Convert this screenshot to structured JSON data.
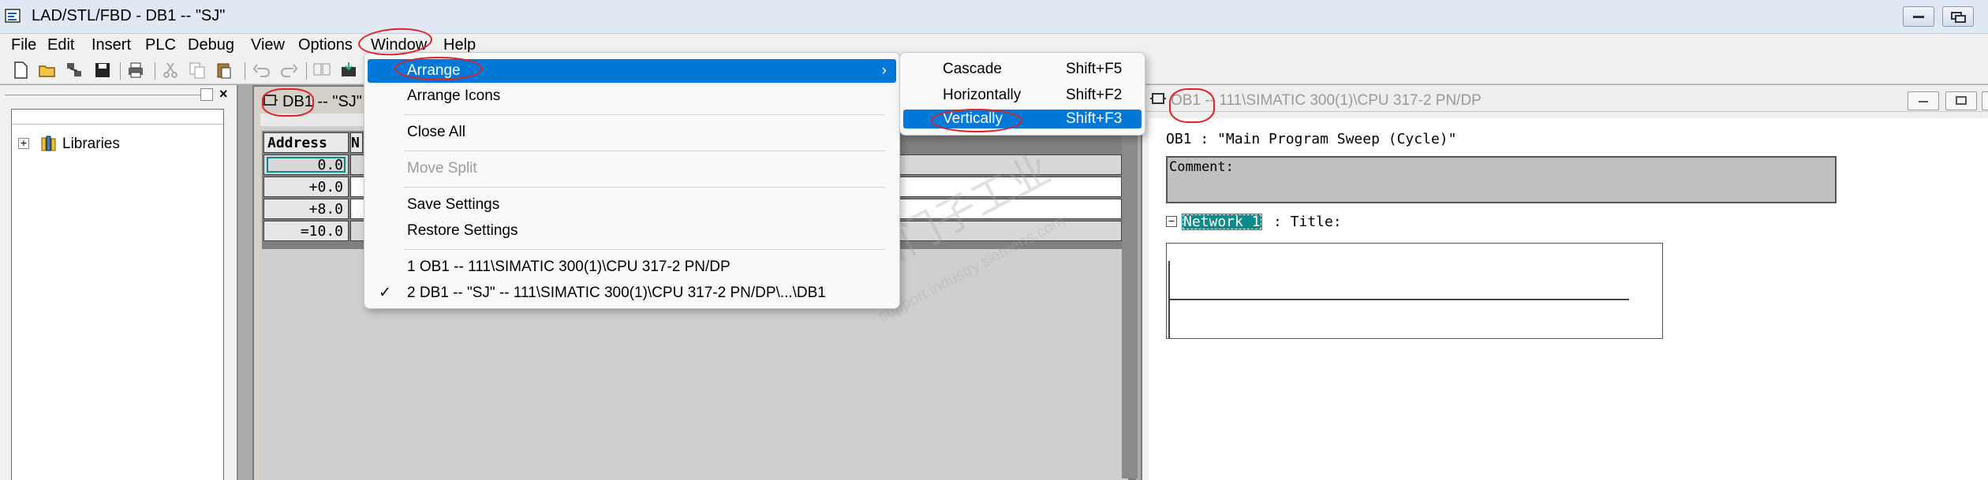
{
  "window": {
    "title": "LAD/STL/FBD  - DB1 -- \"SJ\""
  },
  "menubar": [
    "File",
    "Edit",
    "Insert",
    "PLC",
    "Debug",
    "View",
    "Options",
    "Window",
    "Help"
  ],
  "libraries": {
    "label": "Libraries"
  },
  "db_window": {
    "title": "DB1 -- \"SJ\"",
    "table": {
      "header": [
        "Address",
        "N"
      ],
      "rows": [
        {
          "address": "0.0"
        },
        {
          "address": "+0.0"
        },
        {
          "address": "+8.0"
        },
        {
          "address": "=10.0"
        }
      ]
    }
  },
  "ob_window": {
    "title": "OB1 -- 111\\SIMATIC 300(1)\\CPU 317-2 PN/DP",
    "block_title": "OB1 :  \"Main Program Sweep (Cycle)\"",
    "comment_label": "Comment:",
    "network_label": "Network 1",
    "network_title": ": Title:"
  },
  "window_menu": {
    "items": [
      {
        "label": "Arrange",
        "highlighted": true,
        "submenu": true
      },
      {
        "label": "Arrange Icons"
      },
      {
        "label": "Close All"
      },
      {
        "label": "Move Split",
        "disabled": true
      },
      {
        "label": "Save Settings"
      },
      {
        "label": "Restore Settings"
      },
      {
        "label": "1 OB1 -- 111\\SIMATIC 300(1)\\CPU 317-2 PN/DP"
      },
      {
        "label": "2 DB1 -- \"SJ\" -- 111\\SIMATIC 300(1)\\CPU 317-2 PN/DP\\...\\DB1",
        "checked": true
      }
    ]
  },
  "arrange_menu": {
    "items": [
      {
        "label": "Cascade",
        "shortcut": "Shift+F5"
      },
      {
        "label": "Horizontally",
        "shortcut": "Shift+F2"
      },
      {
        "label": "Vertically",
        "shortcut": "Shift+F3",
        "highlighted": true
      }
    ]
  },
  "watermark": {
    "text": "西门子工业",
    "url": "support.industry.siemens.com"
  },
  "colors": {
    "highlight": "#0078d7",
    "annotation": "#e0202a",
    "network_bg": "#0d8a8a"
  }
}
